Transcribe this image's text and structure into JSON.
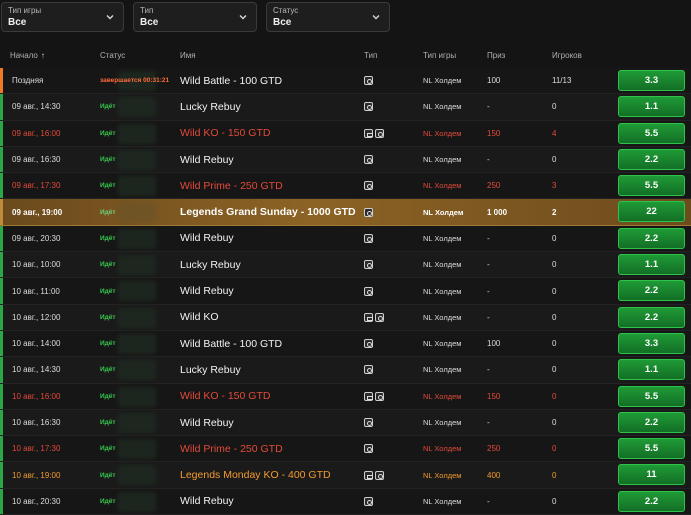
{
  "filters": [
    {
      "label": "Тип игры",
      "value": "Все"
    },
    {
      "label": "Тип",
      "value": "Все"
    },
    {
      "label": "Статус",
      "value": "Все"
    }
  ],
  "columns": {
    "start": "Начало",
    "status": "Статус",
    "name": "Имя",
    "type": "Тип",
    "game_type": "Тип игры",
    "prize": "Приз",
    "players": "Игроков"
  },
  "rows": [
    {
      "start": "Поздняя",
      "status": "завершается 00:31:21",
      "name": "Wild Battle - 100   GTD",
      "types": [
        "plain"
      ],
      "game_type": "NL Холдем",
      "prize": "100",
      "players": "11/13",
      "buyin": "3.3",
      "style": "late"
    },
    {
      "start": "09 авг., 14:30",
      "status": "Идёт",
      "name": "Lucky Rebuy",
      "types": [
        "plain"
      ],
      "game_type": "NL Холдем",
      "prize": "-",
      "players": "0",
      "buyin": "1.1",
      "style": ""
    },
    {
      "start": "09 авг., 16:00",
      "status": "Идёт",
      "name": "Wild KO - 150   GTD",
      "types": [
        "ko",
        "plain"
      ],
      "game_type": "NL Холдем",
      "prize": "150",
      "players": "4",
      "buyin": "5.5",
      "style": "red"
    },
    {
      "start": "09 авг., 16:30",
      "status": "Идёт",
      "name": "Wild Rebuy",
      "types": [
        "plain"
      ],
      "game_type": "NL Холдем",
      "prize": "-",
      "players": "0",
      "buyin": "2.2",
      "style": ""
    },
    {
      "start": "09 авг., 17:30",
      "status": "Идёт",
      "name": "Wild Prime - 250   GTD",
      "types": [
        "plain"
      ],
      "game_type": "NL Холдем",
      "prize": "250",
      "players": "3",
      "buyin": "5.5",
      "style": "red"
    },
    {
      "start": "09 авг., 19:00",
      "status": "Идёт",
      "name": "Legends Grand Sunday - 1000   GTD",
      "types": [
        "plain"
      ],
      "game_type": "NL Холдем",
      "prize": "1 000",
      "players": "2",
      "buyin": "22",
      "style": "featured"
    },
    {
      "start": "09 авг., 20:30",
      "status": "Идёт",
      "name": "Wild Rebuy",
      "types": [
        "plain"
      ],
      "game_type": "NL Холдем",
      "prize": "-",
      "players": "0",
      "buyin": "2.2",
      "style": ""
    },
    {
      "start": "10 авг., 10:00",
      "status": "Идёт",
      "name": "Lucky Rebuy",
      "types": [
        "plain"
      ],
      "game_type": "NL Холдем",
      "prize": "-",
      "players": "0",
      "buyin": "1.1",
      "style": ""
    },
    {
      "start": "10 авг., 11:00",
      "status": "Идёт",
      "name": "Wild Rebuy",
      "types": [
        "plain"
      ],
      "game_type": "NL Холдем",
      "prize": "-",
      "players": "0",
      "buyin": "2.2",
      "style": ""
    },
    {
      "start": "10 авг., 12:00",
      "status": "Идёт",
      "name": "Wild KO",
      "types": [
        "ko",
        "plain"
      ],
      "game_type": "NL Холдем",
      "prize": "-",
      "players": "0",
      "buyin": "2.2",
      "style": ""
    },
    {
      "start": "10 авг., 14:00",
      "status": "Идёт",
      "name": "Wild Battle - 100   GTD",
      "types": [
        "plain"
      ],
      "game_type": "NL Холдем",
      "prize": "100",
      "players": "0",
      "buyin": "3.3",
      "style": ""
    },
    {
      "start": "10 авг., 14:30",
      "status": "Идёт",
      "name": "Lucky Rebuy",
      "types": [
        "plain"
      ],
      "game_type": "NL Холдем",
      "prize": "-",
      "players": "0",
      "buyin": "1.1",
      "style": ""
    },
    {
      "start": "10 авг., 16:00",
      "status": "Идёт",
      "name": "Wild KO - 150   GTD",
      "types": [
        "ko",
        "plain"
      ],
      "game_type": "NL Холдем",
      "prize": "150",
      "players": "0",
      "buyin": "5.5",
      "style": "red"
    },
    {
      "start": "10 авг., 16:30",
      "status": "Идёт",
      "name": "Wild Rebuy",
      "types": [
        "plain"
      ],
      "game_type": "NL Холдем",
      "prize": "-",
      "players": "0",
      "buyin": "2.2",
      "style": ""
    },
    {
      "start": "10 авг., 17:30",
      "status": "Идёт",
      "name": "Wild Prime - 250   GTD",
      "types": [
        "plain"
      ],
      "game_type": "NL Холдем",
      "prize": "250",
      "players": "0",
      "buyin": "5.5",
      "style": "red"
    },
    {
      "start": "10 авг., 19:00",
      "status": "Идёт",
      "name": "Legends Monday KO - 400   GTD",
      "types": [
        "ko",
        "plain"
      ],
      "game_type": "NL Холдем",
      "prize": "400",
      "players": "0",
      "buyin": "11",
      "style": "orange"
    },
    {
      "start": "10 авг., 20:30",
      "status": "Идёт",
      "name": "Wild Rebuy",
      "types": [
        "plain"
      ],
      "game_type": "NL Холдем",
      "prize": "-",
      "players": "0",
      "buyin": "2.2",
      "style": ""
    }
  ],
  "icons": {
    "sort": "arrow-up-icon",
    "chevron": "chevron-down-icon",
    "type_plain": "table-type-icon",
    "type_ko": "knockout-icon"
  },
  "colors": {
    "accent_green": "#2aa845",
    "late_orange": "#f07a24",
    "red": "#e34a3a",
    "gold": "#8c6325"
  }
}
